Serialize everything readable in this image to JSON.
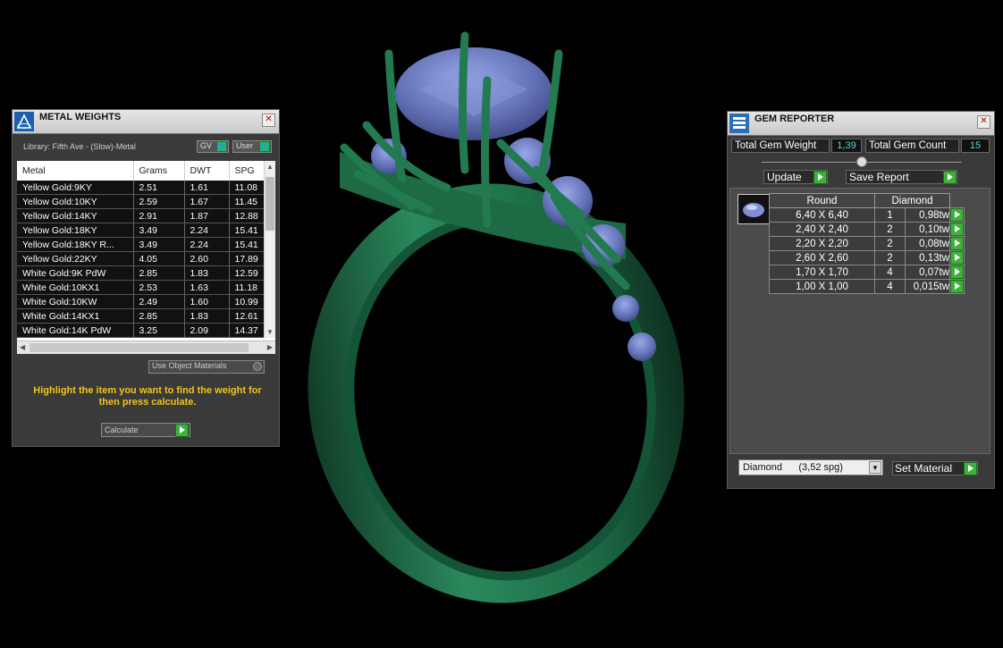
{
  "metal_weights": {
    "title": "METAL WEIGHTS",
    "library": "Library: Fifth Ave - (Slow)-Metal",
    "gv_label": "GV",
    "user_label": "User",
    "columns": [
      "Metal",
      "Grams",
      "DWT",
      "SPG"
    ],
    "rows": [
      [
        "Yellow Gold:9KY",
        "2.51",
        "1.61",
        "11.08"
      ],
      [
        "Yellow Gold:10KY",
        "2.59",
        "1.67",
        "11.45"
      ],
      [
        "Yellow Gold:14KY",
        "2.91",
        "1.87",
        "12.88"
      ],
      [
        "Yellow Gold:18KY",
        "3.49",
        "2.24",
        "15.41"
      ],
      [
        "Yellow Gold:18KY R...",
        "3.49",
        "2.24",
        "15.41"
      ],
      [
        "Yellow Gold:22KY",
        "4.05",
        "2.60",
        "17.89"
      ],
      [
        "White Gold:9K PdW",
        "2.85",
        "1.83",
        "12.59"
      ],
      [
        "White Gold:10KX1",
        "2.53",
        "1.63",
        "11.18"
      ],
      [
        "White Gold:10KW",
        "2.49",
        "1.60",
        "10.99"
      ],
      [
        "White Gold:14KX1",
        "2.85",
        "1.83",
        "12.61"
      ],
      [
        "White Gold:14K PdW",
        "3.25",
        "2.09",
        "14.37"
      ]
    ],
    "use_object_materials": "Use Object Materials",
    "hint": "Highlight the item you want to find the weight for then press calculate.",
    "calculate_label": "Calculate"
  },
  "gem_reporter": {
    "title": "GEM REPORTER",
    "total_weight_label": "Total Gem Weight",
    "total_weight_value": "1,39",
    "total_count_label": "Total Gem Count",
    "total_count_value": "15",
    "update_label": "Update",
    "save_label": "Save Report",
    "columns": [
      "Round",
      "Diamond"
    ],
    "rows": [
      [
        "6,40 X 6,40",
        "1",
        "0,98tw"
      ],
      [
        "2,40 X 2,40",
        "2",
        "0,10tw"
      ],
      [
        "2,20 X 2,20",
        "2",
        "0,08tw"
      ],
      [
        "2,60 X 2,60",
        "2",
        "0,13tw"
      ],
      [
        "1,70 X 1,70",
        "4",
        "0,07tw"
      ],
      [
        "1,00 X 1,00",
        "4",
        "0,015tw"
      ]
    ],
    "material_select": "Diamond      (3,52 spg)",
    "set_material_label": "Set Material"
  },
  "colors": {
    "ring_metal": "#1f6b47",
    "gem": "#6e7fc4",
    "hint": "#f0c419",
    "value": "#4fd3d3",
    "go_button": "#3cb13c"
  },
  "icons": [
    "metal-weights-app-icon",
    "gem-reporter-app-icon",
    "close-icon",
    "go-arrow-icon",
    "dropdown-arrow-icon"
  ]
}
